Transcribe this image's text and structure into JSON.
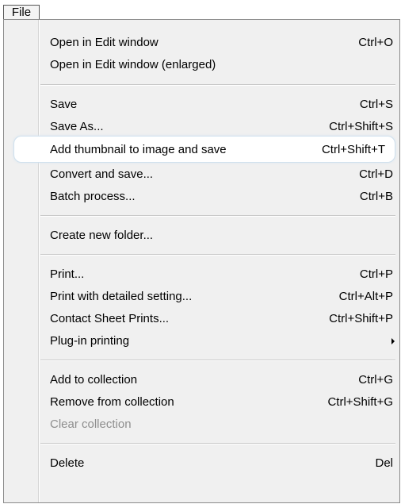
{
  "menubar": {
    "file_label": "File"
  },
  "menu": {
    "items": [
      {
        "label": "Open in Edit window",
        "shortcut": "Ctrl+O"
      },
      {
        "label": "Open in Edit window (enlarged)",
        "shortcut": ""
      },
      {
        "label": "Save",
        "shortcut": "Ctrl+S"
      },
      {
        "label": "Save As...",
        "shortcut": "Ctrl+Shift+S"
      },
      {
        "label": "Add thumbnail to image and save",
        "shortcut": "Ctrl+Shift+T"
      },
      {
        "label": "Convert and save...",
        "shortcut": "Ctrl+D"
      },
      {
        "label": "Batch process...",
        "shortcut": "Ctrl+B"
      },
      {
        "label": "Create new folder...",
        "shortcut": ""
      },
      {
        "label": "Print...",
        "shortcut": "Ctrl+P"
      },
      {
        "label": "Print with detailed setting...",
        "shortcut": "Ctrl+Alt+P"
      },
      {
        "label": "Contact Sheet Prints...",
        "shortcut": "Ctrl+Shift+P"
      },
      {
        "label": "Plug-in printing",
        "shortcut": ""
      },
      {
        "label": "Add to collection",
        "shortcut": "Ctrl+G"
      },
      {
        "label": "Remove from collection",
        "shortcut": "Ctrl+Shift+G"
      },
      {
        "label": "Clear collection",
        "shortcut": ""
      },
      {
        "label": "Delete",
        "shortcut": "Del"
      }
    ]
  },
  "icons": {
    "submenu": "chevron-right-icon"
  },
  "colors": {
    "highlight_border": "#cfe0ee",
    "disabled_text": "#8e8e8e",
    "menu_bg": "#f0f0f0"
  }
}
